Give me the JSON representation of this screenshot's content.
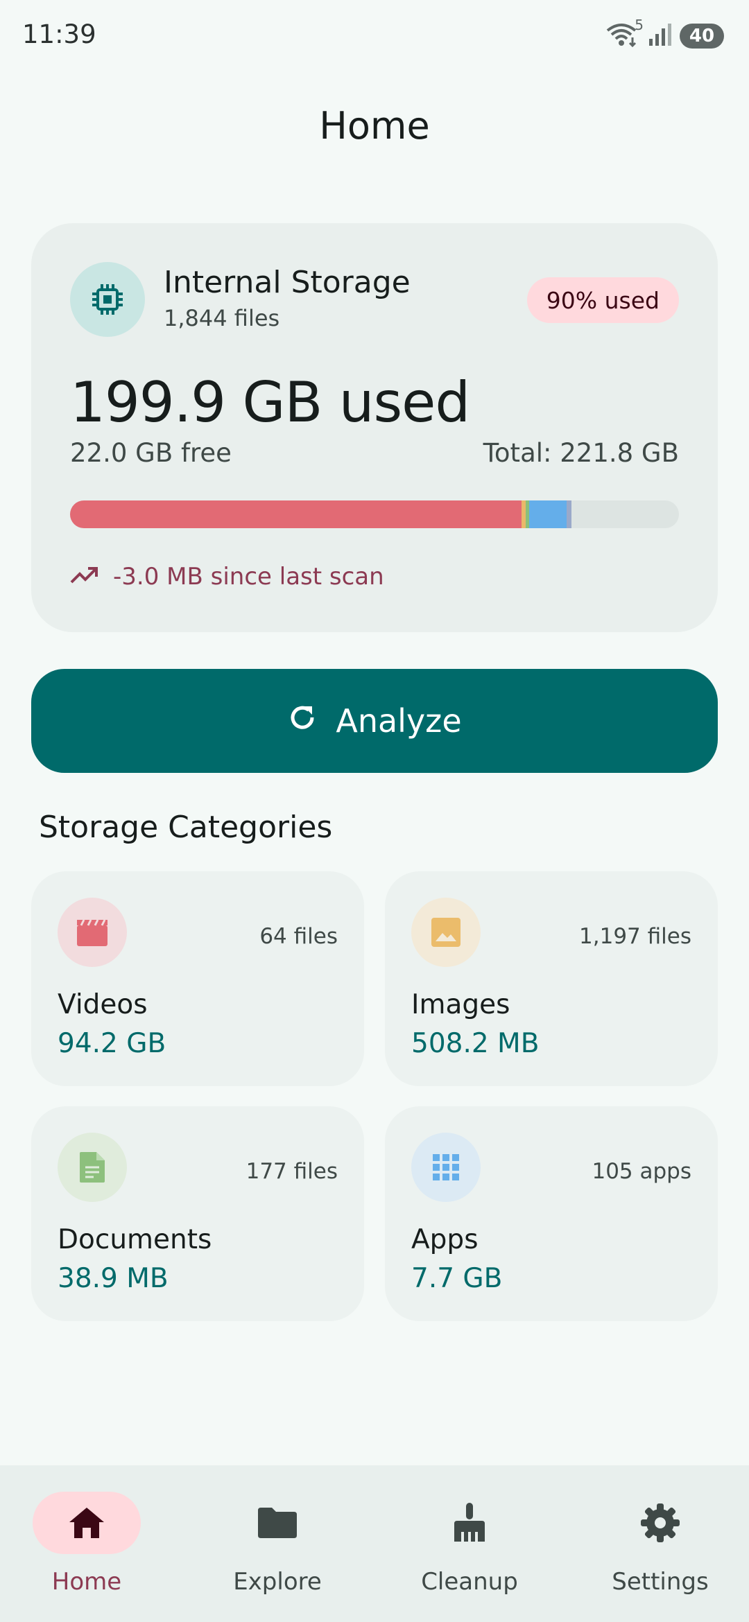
{
  "status_bar": {
    "time": "11:39",
    "network_badge": "5",
    "battery": "40"
  },
  "header": {
    "title": "Home"
  },
  "storage": {
    "name": "Internal Storage",
    "files": "1,844 files",
    "badge": "90% used",
    "used": "199.9 GB used",
    "free": "22.0 GB free",
    "total": "Total: 221.8 GB",
    "trend": "-3.0 MB since last scan",
    "usage_segments": [
      {
        "name": "videos",
        "fraction": 0.742,
        "color": "#e26a74"
      },
      {
        "name": "images",
        "fraction": 0.006,
        "color": "#e9b96a"
      },
      {
        "name": "documents",
        "fraction": 0.006,
        "color": "#8bc07a"
      },
      {
        "name": "apps",
        "fraction": 0.062,
        "color": "#64aeea"
      },
      {
        "name": "other",
        "fraction": 0.008,
        "color": "#9aa9c9"
      }
    ]
  },
  "actions": {
    "analyze_label": "Analyze"
  },
  "categories_section": {
    "title": "Storage Categories",
    "items": [
      {
        "name": "Videos",
        "count": "64 files",
        "size": "94.2 GB",
        "icon": "clapperboard-icon",
        "tint": "#f2dcde",
        "color": "#e26a74"
      },
      {
        "name": "Images",
        "count": "1,197 files",
        "size": "508.2 MB",
        "icon": "image-icon",
        "tint": "#f3ead8",
        "color": "#ebbc6b"
      },
      {
        "name": "Documents",
        "count": "177 files",
        "size": "38.9 MB",
        "icon": "document-icon",
        "tint": "#e0ecdc",
        "color": "#8dc07d"
      },
      {
        "name": "Apps",
        "count": "105 apps",
        "size": "7.7 GB",
        "icon": "apps-grid-icon",
        "tint": "#dceaf4",
        "color": "#64aeea"
      }
    ]
  },
  "bottom_nav": [
    {
      "label": "Home",
      "icon": "home-icon",
      "active": true
    },
    {
      "label": "Explore",
      "icon": "folder-icon",
      "active": false
    },
    {
      "label": "Cleanup",
      "icon": "broom-icon",
      "active": false
    },
    {
      "label": "Settings",
      "icon": "gear-icon",
      "active": false
    }
  ],
  "colors": {
    "primary": "#006a6a",
    "accent_pink": "#ffd9dd",
    "trend": "#8c3a52"
  }
}
